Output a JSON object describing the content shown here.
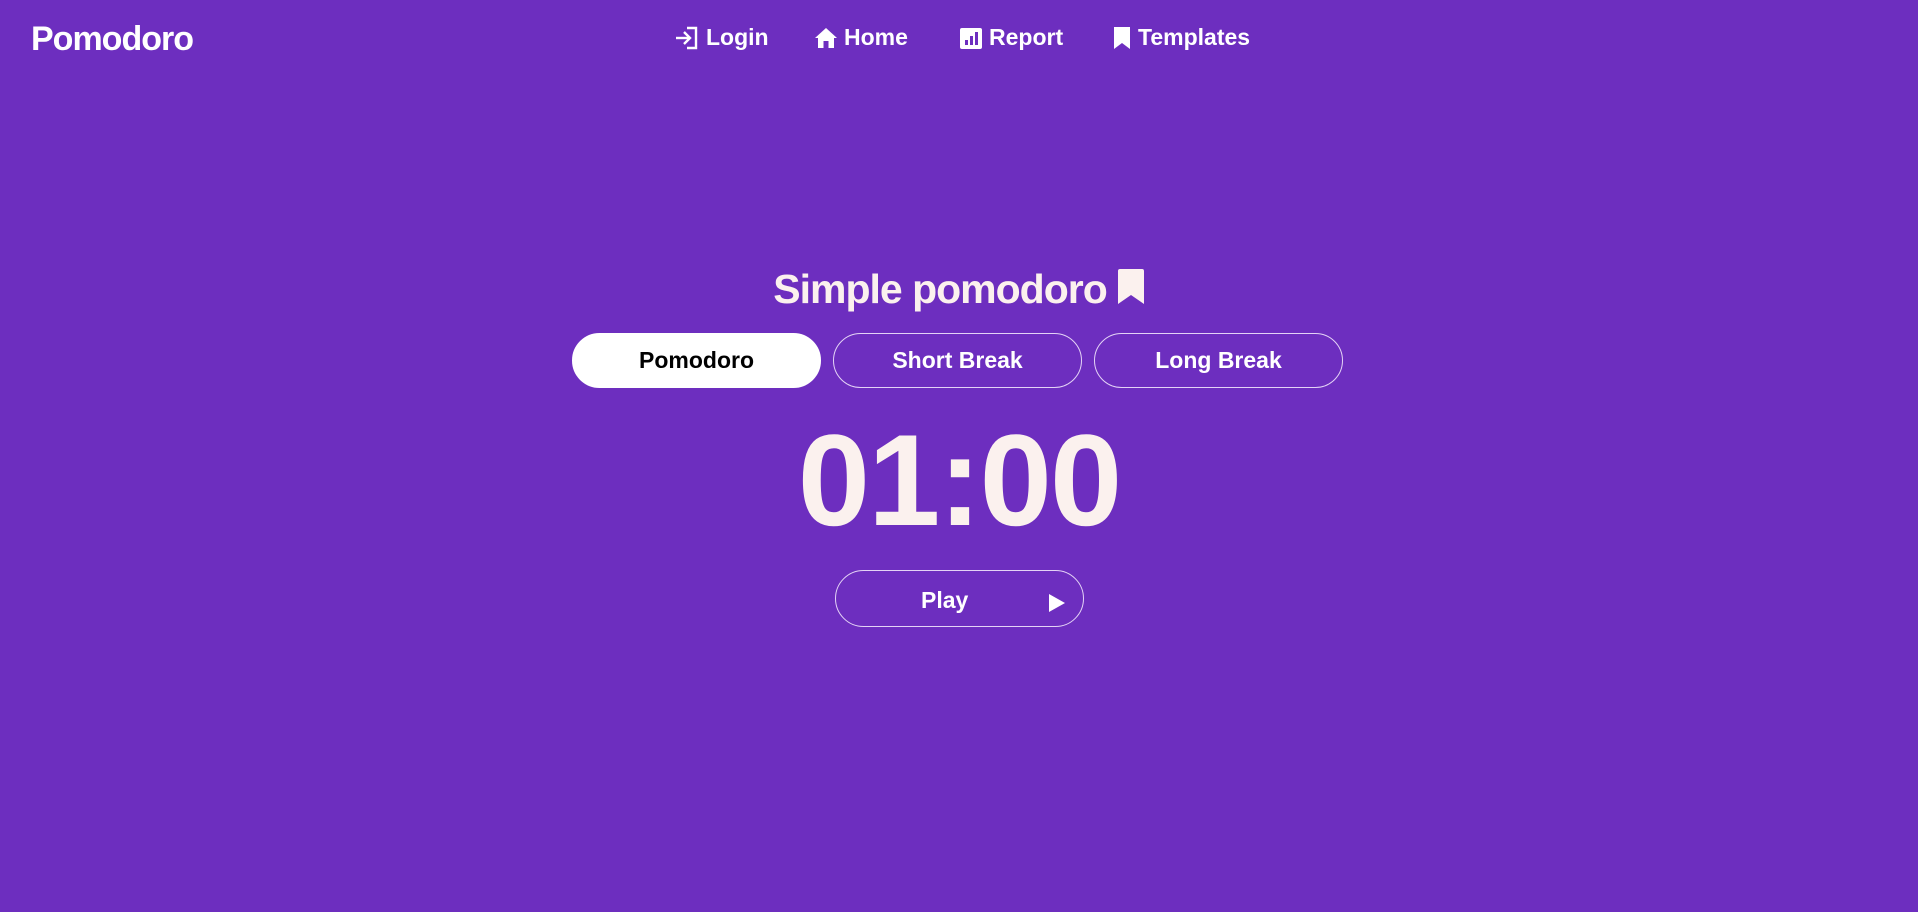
{
  "header": {
    "brand": "Pomodoro",
    "nav": [
      {
        "label": "Login",
        "icon": "login-icon"
      },
      {
        "label": "Home",
        "icon": "home-icon"
      },
      {
        "label": "Report",
        "icon": "report-icon"
      },
      {
        "label": "Templates",
        "icon": "bookmark-icon"
      }
    ]
  },
  "main": {
    "title": "Simple pomodoro",
    "title_icon": "bookmark-icon",
    "modes": [
      {
        "label": "Pomodoro",
        "active": true
      },
      {
        "label": "Short Break",
        "active": false
      },
      {
        "label": "Long Break",
        "active": false
      }
    ],
    "timer": "01:00",
    "play_label": "Play",
    "play_icon": "play-icon"
  },
  "colors": {
    "background": "#6d2ebf",
    "text": "#ffffff",
    "timer_text": "#fbf1ee",
    "active_button_bg": "#ffffff",
    "active_button_text": "#000000"
  }
}
